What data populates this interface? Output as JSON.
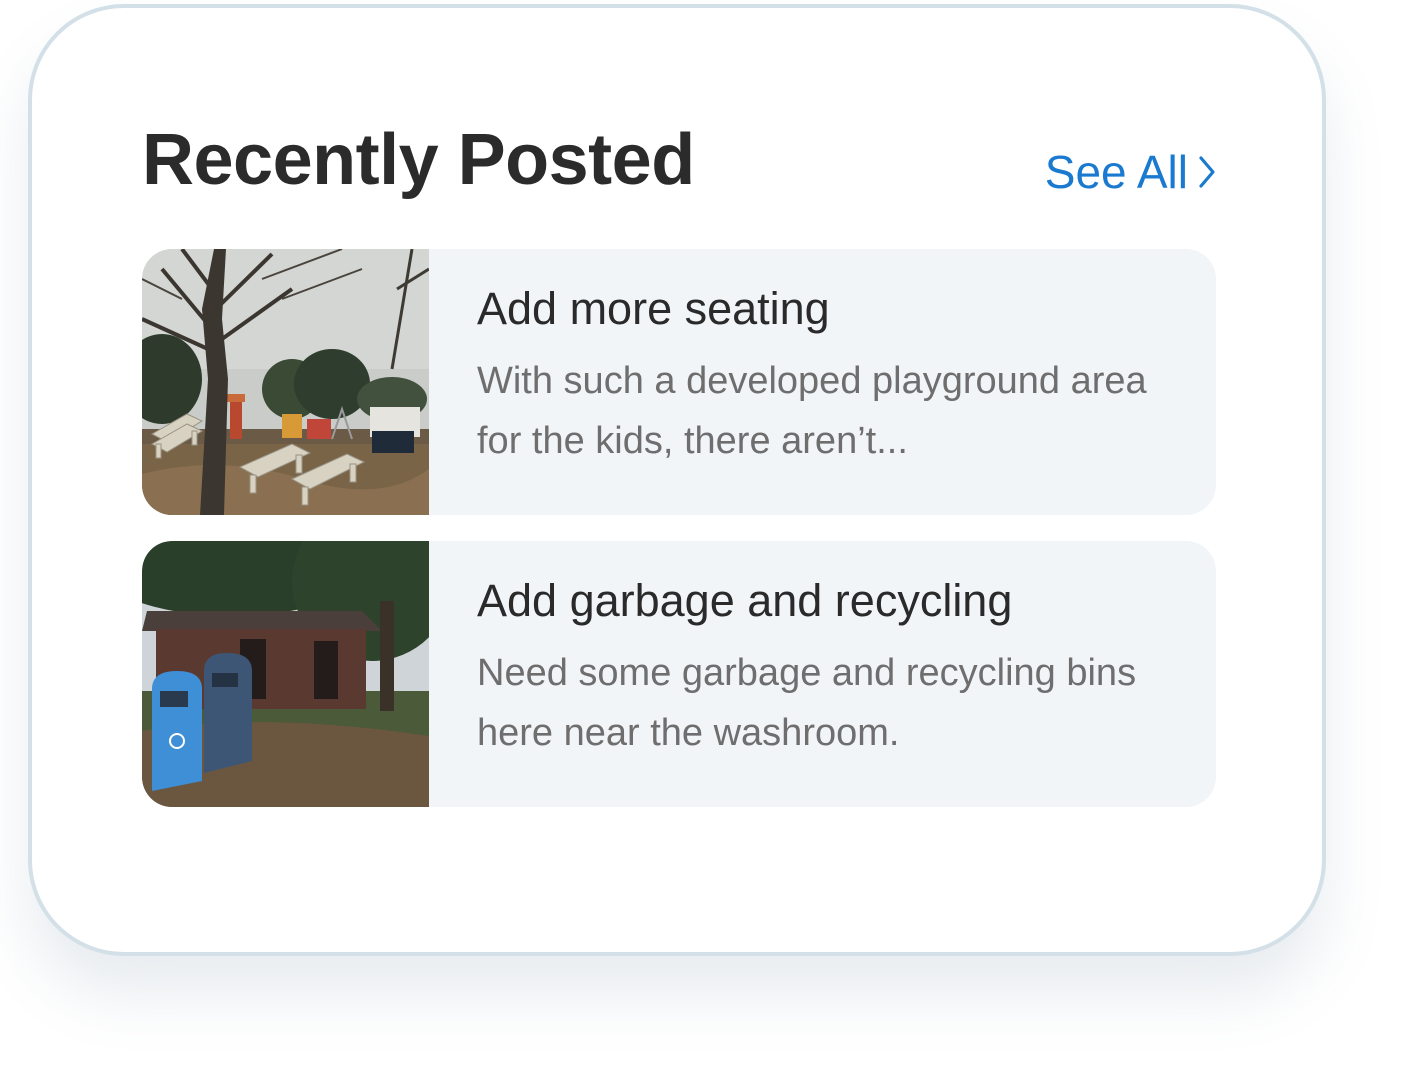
{
  "header": {
    "title": "Recently Posted",
    "see_all_label": "See All"
  },
  "posts": [
    {
      "title": "Add more seating",
      "description": " With such a developed playground area for the kids, there aren’t..."
    },
    {
      "title": "Add garbage and recycling",
      "description": "Need some garbage and recycling bins here near the washroom."
    }
  ],
  "colors": {
    "accent": "#1a7ad0",
    "card_border": "#d3e0e8",
    "post_background": "#f2f5f8",
    "title_text": "#2b2b2b",
    "description_text": "#6e6e6e"
  },
  "icons": [
    "chevron-right-icon"
  ]
}
